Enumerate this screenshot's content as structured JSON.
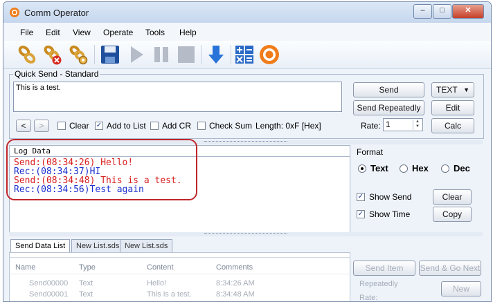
{
  "window": {
    "title": "Comm Operator",
    "minimize": "–",
    "maximize": "□",
    "close": "✕"
  },
  "menu": [
    "File",
    "Edit",
    "View",
    "Operate",
    "Tools",
    "Help"
  ],
  "toolbar_icons": [
    "connect-icon",
    "disconnect-icon",
    "settings-link-icon",
    "save-icon",
    "play-icon",
    "pause-icon",
    "stop-icon",
    "download-icon",
    "calculator-icon",
    "app-logo-icon"
  ],
  "quick_send": {
    "group_label": "Quick Send - Standard",
    "text": "This is a test.",
    "send": "Send",
    "send_repeatedly": "Send Repeatedly",
    "format_value": "TEXT",
    "edit": "Edit",
    "calc": "Calc",
    "rate_label": "Rate:",
    "rate_value": "1",
    "prev": "<",
    "next": ">",
    "clear_label": "Clear",
    "add_to_list_label": "Add to List",
    "add_cr_label": "Add CR",
    "check_sum_label": "Check Sum",
    "length": "Length: 0xF [Hex]"
  },
  "log": {
    "label": "Log Data",
    "lines": [
      {
        "text": "Send:(08:34:26) Hello!",
        "color": "#d81e1e"
      },
      {
        "text": "Rec:(08:34:37)HI",
        "color": "#1a2fd0"
      },
      {
        "text": "Send:(08:34:48) This is a test.",
        "color": "#d81e1e"
      },
      {
        "text": "Rec:(08:34:56)Test again",
        "color": "#1a2fd0"
      }
    ]
  },
  "format": {
    "label": "Format",
    "text": "Text",
    "hex": "Hex",
    "dec": "Dec",
    "show_send": "Show Send",
    "show_time": "Show Time",
    "clear": "Clear",
    "copy": "Copy"
  },
  "tabs": [
    "Send Data List",
    "New List.sds",
    "New List.sds"
  ],
  "list": {
    "columns": [
      "Name",
      "Type",
      "Content",
      "Comments"
    ],
    "rows": [
      {
        "name": "Send00000",
        "type": "Text",
        "content": "Hello!",
        "comments": "8:34:26 AM"
      },
      {
        "name": "Send00001",
        "type": "Text",
        "content": "This is a test.",
        "comments": "8:34:48 AM"
      }
    ],
    "send_item": "Send Item",
    "send_go_next": "Send & Go Next",
    "repeatedly": "Repeatedly",
    "new": "New",
    "rate": "Rate:"
  },
  "colors": {
    "accent_orange": "#f07d1a",
    "log_highlight": "#c0262a"
  }
}
